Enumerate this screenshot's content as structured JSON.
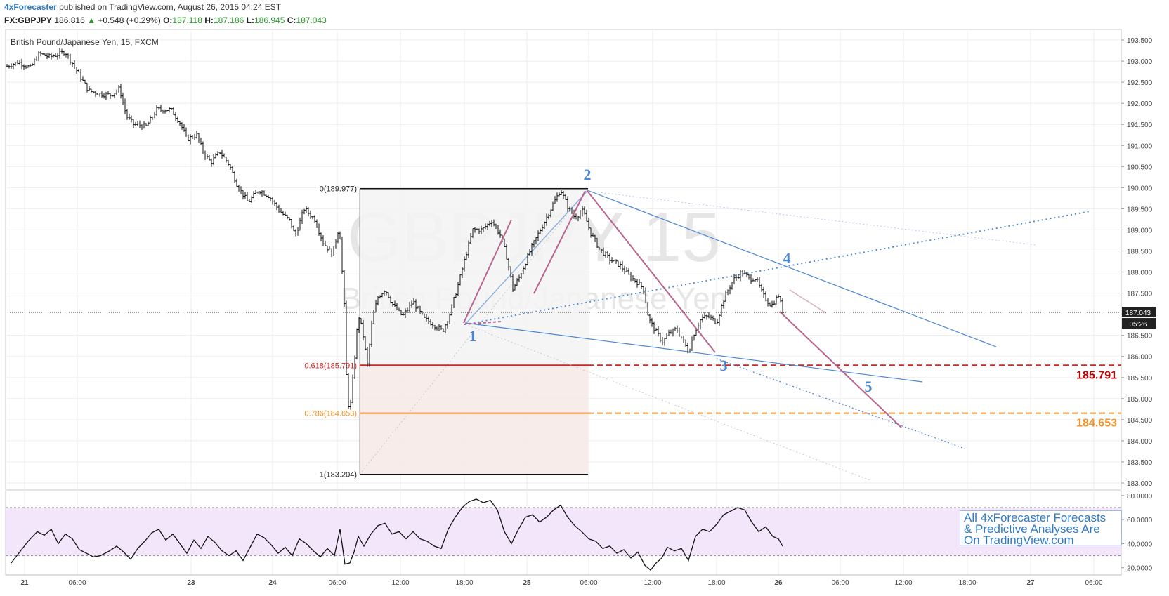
{
  "header": {
    "publisher": "4xForecaster",
    "published_text": "published on TradingView.com, August 26, 2015 04:24 EST"
  },
  "quote": {
    "symbol": "FX:GBPJPY",
    "last": "186.816",
    "change_arrow": "▲",
    "change": "+0.548 (+0.29%)",
    "o_label": "O:",
    "o": "187.118",
    "h_label": "H:",
    "h": "187.186",
    "l_label": "L:",
    "l": "186.945",
    "c_label": "C:",
    "c": "187.043"
  },
  "instrument_label": "British Pound/Japanese Yen, 15, FXCM",
  "watermark": {
    "symbol": "GBPJPY 15",
    "name": "British Pound/Japanese Yen"
  },
  "promo": {
    "line1": "All 4xForecaster Forecasts",
    "line2": "& Predictive Analyses Are",
    "line3": "On TradingView.com"
  },
  "colors": {
    "candle": "#111111",
    "fib_red": "#e31e1e",
    "fib_orange": "#f0922b",
    "wave_blue": "#4a86d4",
    "trend_pink": "#b9648e",
    "rsi_band": "#f3e6fb"
  },
  "chart_data": [
    {
      "type": "ohlc",
      "title": "British Pound/Japanese Yen, 15, FXCM",
      "x_tick_labels": [
        "21",
        "06:00",
        "23",
        "24",
        "06:00",
        "12:00",
        "18:00",
        "25",
        "06:00",
        "12:00",
        "18:00",
        "26",
        "06:00",
        "12:00",
        "18:00",
        "27",
        "06:00"
      ],
      "y_tick_labels": [
        "193.500",
        "193.000",
        "192.500",
        "192.000",
        "191.500",
        "191.000",
        "190.500",
        "190.000",
        "189.500",
        "189.000",
        "188.500",
        "188.000",
        "187.500",
        "187.000",
        "186.500",
        "186.000",
        "185.500",
        "185.000",
        "184.500",
        "184.000",
        "183.500",
        "183.000"
      ],
      "ylim": [
        182.85,
        193.75
      ],
      "grid": true,
      "price_path": [
        {
          "x": 0,
          "y": 192.87
        },
        {
          "x": 18,
          "y": 192.98
        },
        {
          "x": 28,
          "y": 192.9
        },
        {
          "x": 35,
          "y": 192.84
        },
        {
          "x": 48,
          "y": 193.18
        },
        {
          "x": 62,
          "y": 193.1
        },
        {
          "x": 72,
          "y": 193.15
        },
        {
          "x": 85,
          "y": 193.22
        },
        {
          "x": 95,
          "y": 192.95
        },
        {
          "x": 108,
          "y": 192.58
        },
        {
          "x": 118,
          "y": 192.3
        },
        {
          "x": 135,
          "y": 192.22
        },
        {
          "x": 150,
          "y": 192.2
        },
        {
          "x": 162,
          "y": 192.35
        },
        {
          "x": 172,
          "y": 191.7
        },
        {
          "x": 182,
          "y": 191.5
        },
        {
          "x": 200,
          "y": 191.45
        },
        {
          "x": 215,
          "y": 191.85
        },
        {
          "x": 235,
          "y": 191.85
        },
        {
          "x": 248,
          "y": 191.55
        },
        {
          "x": 258,
          "y": 191.15
        },
        {
          "x": 272,
          "y": 191.25
        },
        {
          "x": 282,
          "y": 190.82
        },
        {
          "x": 292,
          "y": 190.6
        },
        {
          "x": 305,
          "y": 190.85
        },
        {
          "x": 318,
          "y": 190.55
        },
        {
          "x": 330,
          "y": 190.05
        },
        {
          "x": 345,
          "y": 189.65
        },
        {
          "x": 360,
          "y": 189.95
        },
        {
          "x": 375,
          "y": 189.8
        },
        {
          "x": 390,
          "y": 189.45
        },
        {
          "x": 405,
          "y": 189.2
        },
        {
          "x": 412,
          "y": 188.85
        },
        {
          "x": 425,
          "y": 189.5
        },
        {
          "x": 440,
          "y": 189.25
        },
        {
          "x": 452,
          "y": 188.7
        },
        {
          "x": 465,
          "y": 188.42
        },
        {
          "x": 475,
          "y": 189.1
        },
        {
          "x": 482,
          "y": 187.2
        },
        {
          "x": 486,
          "y": 185.0
        },
        {
          "x": 490,
          "y": 184.7
        },
        {
          "x": 496,
          "y": 185.8
        },
        {
          "x": 502,
          "y": 187.0
        },
        {
          "x": 508,
          "y": 186.6
        },
        {
          "x": 515,
          "y": 185.8
        },
        {
          "x": 522,
          "y": 186.9
        },
        {
          "x": 530,
          "y": 187.4
        },
        {
          "x": 540,
          "y": 187.6
        },
        {
          "x": 552,
          "y": 187.2
        },
        {
          "x": 565,
          "y": 186.95
        },
        {
          "x": 580,
          "y": 187.3
        },
        {
          "x": 595,
          "y": 186.9
        },
        {
          "x": 610,
          "y": 186.75
        },
        {
          "x": 622,
          "y": 186.6
        },
        {
          "x": 632,
          "y": 187.0
        },
        {
          "x": 645,
          "y": 187.75
        },
        {
          "x": 655,
          "y": 188.4
        },
        {
          "x": 665,
          "y": 189.0
        },
        {
          "x": 678,
          "y": 189.0
        },
        {
          "x": 692,
          "y": 189.22
        },
        {
          "x": 705,
          "y": 188.85
        },
        {
          "x": 714,
          "y": 188.3
        },
        {
          "x": 722,
          "y": 187.6
        },
        {
          "x": 732,
          "y": 187.9
        },
        {
          "x": 745,
          "y": 188.45
        },
        {
          "x": 758,
          "y": 188.9
        },
        {
          "x": 770,
          "y": 189.3
        },
        {
          "x": 782,
          "y": 189.7
        },
        {
          "x": 790,
          "y": 189.95
        },
        {
          "x": 800,
          "y": 189.55
        },
        {
          "x": 810,
          "y": 189.3
        },
        {
          "x": 822,
          "y": 189.45
        },
        {
          "x": 832,
          "y": 188.95
        },
        {
          "x": 845,
          "y": 188.55
        },
        {
          "x": 860,
          "y": 188.3
        },
        {
          "x": 875,
          "y": 188.15
        },
        {
          "x": 888,
          "y": 187.9
        },
        {
          "x": 900,
          "y": 187.75
        },
        {
          "x": 908,
          "y": 187.6
        },
        {
          "x": 915,
          "y": 186.9
        },
        {
          "x": 925,
          "y": 186.6
        },
        {
          "x": 935,
          "y": 186.35
        },
        {
          "x": 945,
          "y": 186.55
        },
        {
          "x": 955,
          "y": 186.65
        },
        {
          "x": 965,
          "y": 186.35
        },
        {
          "x": 972,
          "y": 186.1
        },
        {
          "x": 980,
          "y": 186.55
        },
        {
          "x": 990,
          "y": 186.9
        },
        {
          "x": 1000,
          "y": 186.95
        },
        {
          "x": 1012,
          "y": 186.8
        },
        {
          "x": 1022,
          "y": 187.35
        },
        {
          "x": 1035,
          "y": 187.8
        },
        {
          "x": 1048,
          "y": 188.0
        },
        {
          "x": 1058,
          "y": 187.85
        },
        {
          "x": 1068,
          "y": 187.85
        },
        {
          "x": 1078,
          "y": 187.45
        },
        {
          "x": 1090,
          "y": 187.2
        },
        {
          "x": 1100,
          "y": 187.45
        },
        {
          "x": 1108,
          "y": 186.95
        }
      ],
      "last_price_label": "187.043",
      "countdown_label": "05:26",
      "fibonacci": {
        "levels": [
          {
            "label": "0(189.977)",
            "price": 189.977
          },
          {
            "label": "0.618(185.791)",
            "price": 185.791
          },
          {
            "label": "0.786(184.653)",
            "price": 184.653
          },
          {
            "label": "1(183.204)",
            "price": 183.204
          }
        ],
        "right_labels": [
          "185.791",
          "184.653"
        ]
      },
      "wave_labels": [
        "1",
        "2",
        "3",
        "4",
        "5"
      ]
    },
    {
      "type": "line",
      "title": "",
      "y_tick_labels": [
        "80.0000",
        "60.0000",
        "40.0000",
        "20.0000"
      ],
      "ylim": [
        14,
        84
      ],
      "bands": [
        30,
        70
      ],
      "values": [
        {
          "x": 8,
          "y": 24
        },
        {
          "x": 20,
          "y": 33
        },
        {
          "x": 32,
          "y": 42
        },
        {
          "x": 45,
          "y": 50
        },
        {
          "x": 55,
          "y": 47
        },
        {
          "x": 65,
          "y": 52
        },
        {
          "x": 75,
          "y": 40
        },
        {
          "x": 85,
          "y": 48
        },
        {
          "x": 95,
          "y": 44
        },
        {
          "x": 105,
          "y": 35
        },
        {
          "x": 115,
          "y": 32
        },
        {
          "x": 125,
          "y": 29
        },
        {
          "x": 135,
          "y": 30
        },
        {
          "x": 148,
          "y": 34
        },
        {
          "x": 158,
          "y": 38
        },
        {
          "x": 168,
          "y": 33
        },
        {
          "x": 178,
          "y": 27
        },
        {
          "x": 188,
          "y": 36
        },
        {
          "x": 198,
          "y": 42
        },
        {
          "x": 208,
          "y": 49
        },
        {
          "x": 218,
          "y": 52
        },
        {
          "x": 228,
          "y": 43
        },
        {
          "x": 238,
          "y": 48
        },
        {
          "x": 248,
          "y": 40
        },
        {
          "x": 258,
          "y": 32
        },
        {
          "x": 268,
          "y": 43
        },
        {
          "x": 278,
          "y": 36
        },
        {
          "x": 288,
          "y": 46
        },
        {
          "x": 298,
          "y": 41
        },
        {
          "x": 308,
          "y": 34
        },
        {
          "x": 318,
          "y": 30
        },
        {
          "x": 328,
          "y": 34
        },
        {
          "x": 338,
          "y": 26
        },
        {
          "x": 348,
          "y": 37
        },
        {
          "x": 358,
          "y": 48
        },
        {
          "x": 368,
          "y": 45
        },
        {
          "x": 378,
          "y": 39
        },
        {
          "x": 388,
          "y": 32
        },
        {
          "x": 398,
          "y": 37
        },
        {
          "x": 408,
          "y": 30
        },
        {
          "x": 418,
          "y": 44
        },
        {
          "x": 428,
          "y": 40
        },
        {
          "x": 438,
          "y": 34
        },
        {
          "x": 448,
          "y": 29
        },
        {
          "x": 458,
          "y": 36
        },
        {
          "x": 468,
          "y": 30
        },
        {
          "x": 476,
          "y": 52
        },
        {
          "x": 483,
          "y": 23
        },
        {
          "x": 490,
          "y": 24
        },
        {
          "x": 496,
          "y": 33
        },
        {
          "x": 502,
          "y": 46
        },
        {
          "x": 510,
          "y": 38
        },
        {
          "x": 520,
          "y": 48
        },
        {
          "x": 530,
          "y": 55
        },
        {
          "x": 540,
          "y": 57
        },
        {
          "x": 550,
          "y": 48
        },
        {
          "x": 560,
          "y": 50
        },
        {
          "x": 570,
          "y": 44
        },
        {
          "x": 580,
          "y": 50
        },
        {
          "x": 590,
          "y": 44
        },
        {
          "x": 600,
          "y": 42
        },
        {
          "x": 610,
          "y": 38
        },
        {
          "x": 620,
          "y": 36
        },
        {
          "x": 630,
          "y": 52
        },
        {
          "x": 640,
          "y": 62
        },
        {
          "x": 650,
          "y": 70
        },
        {
          "x": 660,
          "y": 75
        },
        {
          "x": 670,
          "y": 77
        },
        {
          "x": 680,
          "y": 74
        },
        {
          "x": 690,
          "y": 76
        },
        {
          "x": 700,
          "y": 68
        },
        {
          "x": 710,
          "y": 50
        },
        {
          "x": 720,
          "y": 40
        },
        {
          "x": 730,
          "y": 52
        },
        {
          "x": 740,
          "y": 62
        },
        {
          "x": 750,
          "y": 64
        },
        {
          "x": 760,
          "y": 58
        },
        {
          "x": 770,
          "y": 62
        },
        {
          "x": 780,
          "y": 68
        },
        {
          "x": 790,
          "y": 72
        },
        {
          "x": 800,
          "y": 62
        },
        {
          "x": 810,
          "y": 55
        },
        {
          "x": 820,
          "y": 50
        },
        {
          "x": 830,
          "y": 44
        },
        {
          "x": 840,
          "y": 42
        },
        {
          "x": 850,
          "y": 36
        },
        {
          "x": 860,
          "y": 38
        },
        {
          "x": 870,
          "y": 32
        },
        {
          "x": 880,
          "y": 35
        },
        {
          "x": 890,
          "y": 28
        },
        {
          "x": 900,
          "y": 33
        },
        {
          "x": 910,
          "y": 22
        },
        {
          "x": 918,
          "y": 18
        },
        {
          "x": 926,
          "y": 24
        },
        {
          "x": 934,
          "y": 28
        },
        {
          "x": 942,
          "y": 37
        },
        {
          "x": 952,
          "y": 34
        },
        {
          "x": 962,
          "y": 36
        },
        {
          "x": 972,
          "y": 26
        },
        {
          "x": 982,
          "y": 46
        },
        {
          "x": 992,
          "y": 52
        },
        {
          "x": 1002,
          "y": 50
        },
        {
          "x": 1012,
          "y": 56
        },
        {
          "x": 1022,
          "y": 64
        },
        {
          "x": 1032,
          "y": 67
        },
        {
          "x": 1042,
          "y": 70
        },
        {
          "x": 1052,
          "y": 68
        },
        {
          "x": 1062,
          "y": 58
        },
        {
          "x": 1072,
          "y": 50
        },
        {
          "x": 1082,
          "y": 54
        },
        {
          "x": 1092,
          "y": 46
        },
        {
          "x": 1100,
          "y": 44
        },
        {
          "x": 1106,
          "y": 38
        }
      ]
    }
  ]
}
